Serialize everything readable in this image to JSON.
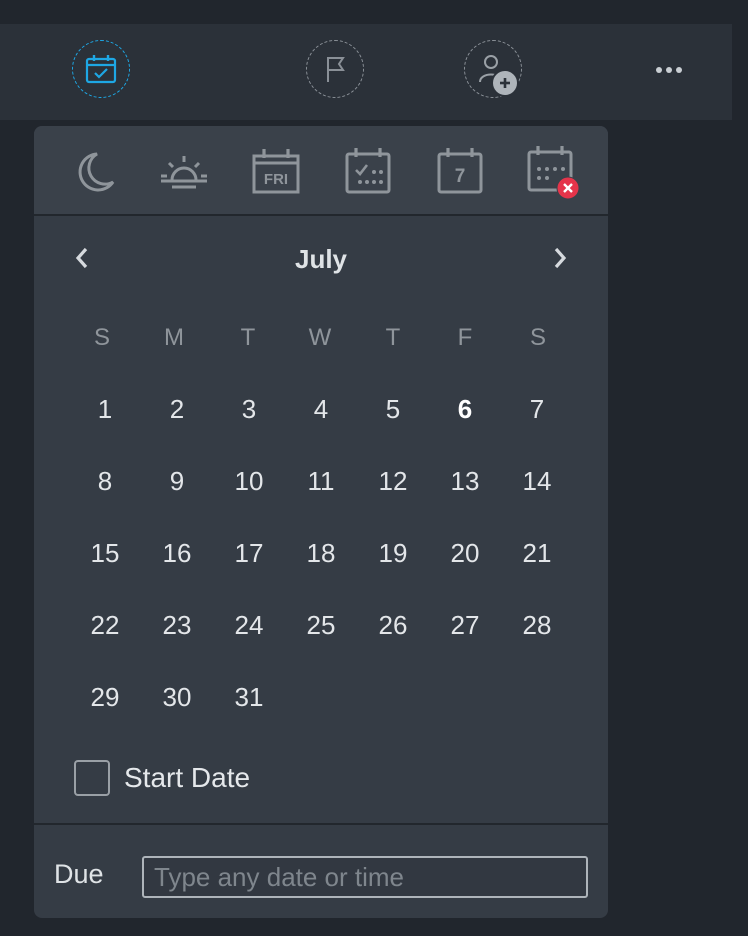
{
  "toolbar": {
    "buttons": [
      {
        "icon": "calendar-check-icon",
        "active": true
      },
      {
        "icon": "flag-icon"
      },
      {
        "icon": "add-person-icon"
      },
      {
        "icon": "more-icon"
      }
    ],
    "accent_color": "#1ea7e4"
  },
  "quick_dates": [
    {
      "icon": "moon-icon"
    },
    {
      "icon": "sunrise-icon"
    },
    {
      "icon": "calendar-fri-icon",
      "text": "FRI"
    },
    {
      "icon": "calendar-weekend-icon"
    },
    {
      "icon": "calendar-7-icon",
      "text": "7"
    },
    {
      "icon": "calendar-remove-icon"
    }
  ],
  "calendar": {
    "month": "July",
    "weekdays": [
      "S",
      "M",
      "T",
      "W",
      "T",
      "F",
      "S"
    ],
    "weeks": [
      [
        "1",
        "2",
        "3",
        "4",
        "5",
        "6",
        "7"
      ],
      [
        "8",
        "9",
        "10",
        "11",
        "12",
        "13",
        "14"
      ],
      [
        "15",
        "16",
        "17",
        "18",
        "19",
        "20",
        "21"
      ],
      [
        "22",
        "23",
        "24",
        "25",
        "26",
        "27",
        "28"
      ],
      [
        "29",
        "30",
        "31",
        "",
        "",
        "",
        ""
      ]
    ],
    "today": "6"
  },
  "start_date": {
    "label": "Start Date",
    "checked": false
  },
  "due": {
    "label": "Due",
    "placeholder": "Type any date or time",
    "value": ""
  },
  "colors": {
    "remove_badge": "#e5344a"
  }
}
